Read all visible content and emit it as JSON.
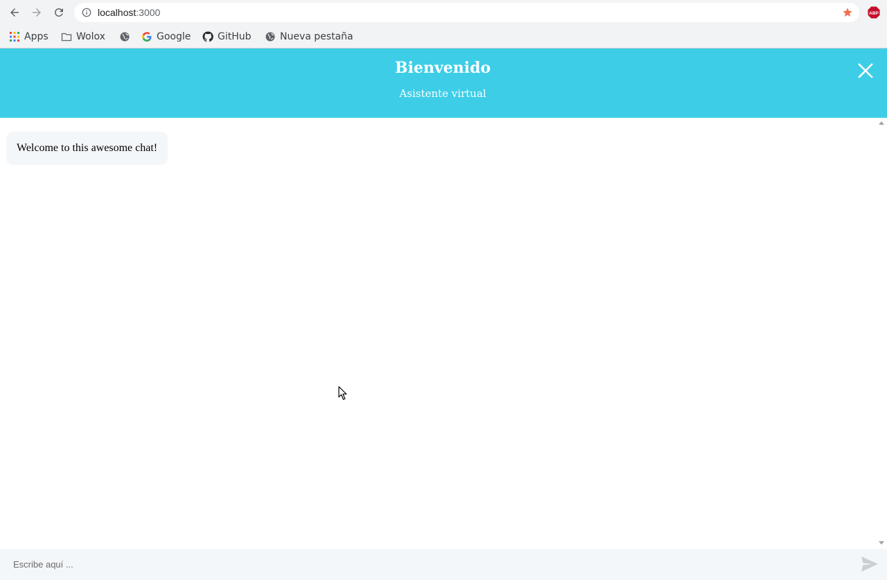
{
  "browser": {
    "url_host": "localhost",
    "url_port": ":3000",
    "back_icon": "arrow-left-icon",
    "forward_icon": "arrow-right-icon",
    "reload_icon": "reload-icon",
    "bookmark_star_color": "#f0714f",
    "extension_label": "ABP"
  },
  "bookmarks": [
    {
      "label": "Apps",
      "icon": "apps-grid-icon"
    },
    {
      "label": "Wolox",
      "icon": "folder-icon"
    },
    {
      "label": "",
      "icon": "globe-icon"
    },
    {
      "label": "Google",
      "icon": "google-icon"
    },
    {
      "label": "GitHub",
      "icon": "github-icon"
    },
    {
      "label": "Nueva pestaña",
      "icon": "globe-icon"
    }
  ],
  "chat": {
    "accent_color": "#3dcde7",
    "title": "Bienvenido",
    "subtitle": "Asistente virtual",
    "messages": [
      {
        "text": "Welcome to this awesome chat!",
        "sender": "bot"
      }
    ],
    "input": {
      "value": "",
      "placeholder": "Escribe aquí ..."
    }
  }
}
